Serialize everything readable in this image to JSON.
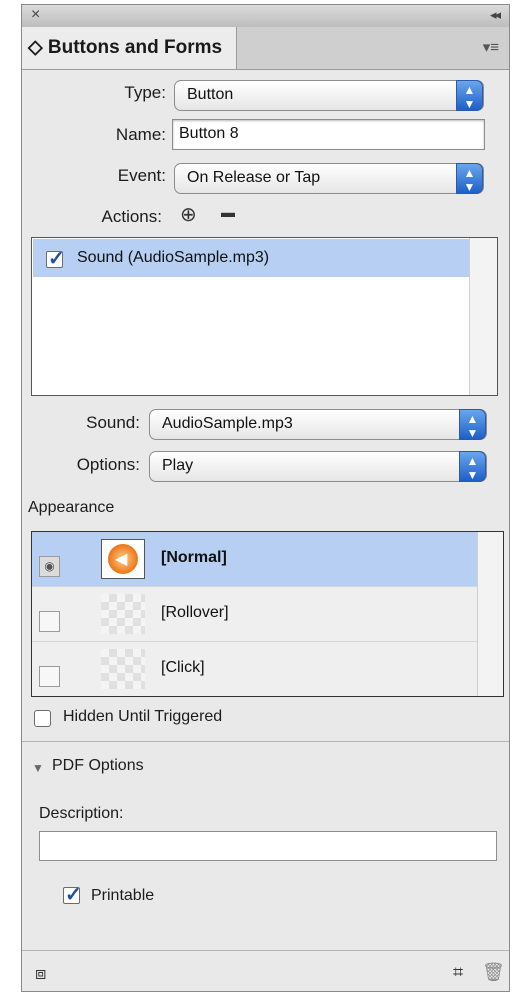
{
  "panel": {
    "close_glyph": "×",
    "collapse_glyph": "◂◂",
    "tab_title": "◇ Buttons and Forms",
    "panel_menu_glyph": "▾≡"
  },
  "form": {
    "type_label": "Type:",
    "type_value": "Button",
    "name_label": "Name:",
    "name_value": "Button 8",
    "event_label": "Event:",
    "event_value": "On Release or Tap",
    "actions_label": "Actions:",
    "add_action_glyph": "⊕",
    "remove_action_glyph": "▬"
  },
  "actions_list": [
    {
      "label": "Sound (AudioSample.mp3)",
      "checked": true
    }
  ],
  "sound": {
    "sound_label": "Sound:",
    "sound_value": "AudioSample.mp3",
    "options_label": "Options:",
    "options_value": "Play"
  },
  "appearance": {
    "heading": "Appearance",
    "states": [
      {
        "label": "[Normal]",
        "selected": true
      },
      {
        "label": "[Rollover]",
        "selected": false
      },
      {
        "label": "[Click]",
        "selected": false
      }
    ],
    "hidden_label": "Hidden Until Triggered",
    "hidden_checked": false
  },
  "pdf": {
    "heading": "PDF Options",
    "description_label": "Description:",
    "description_value": "",
    "printable_label": "Printable",
    "printable_checked": true
  },
  "footer": {
    "preview_icon": "preview-icon",
    "convert_icon": "convert-to-button-icon",
    "delete_icon": "trash-icon"
  },
  "colors": {
    "accent": "#1d5fc9",
    "selection": "#b6cff3",
    "panel_bg": "#e9e9e9"
  }
}
